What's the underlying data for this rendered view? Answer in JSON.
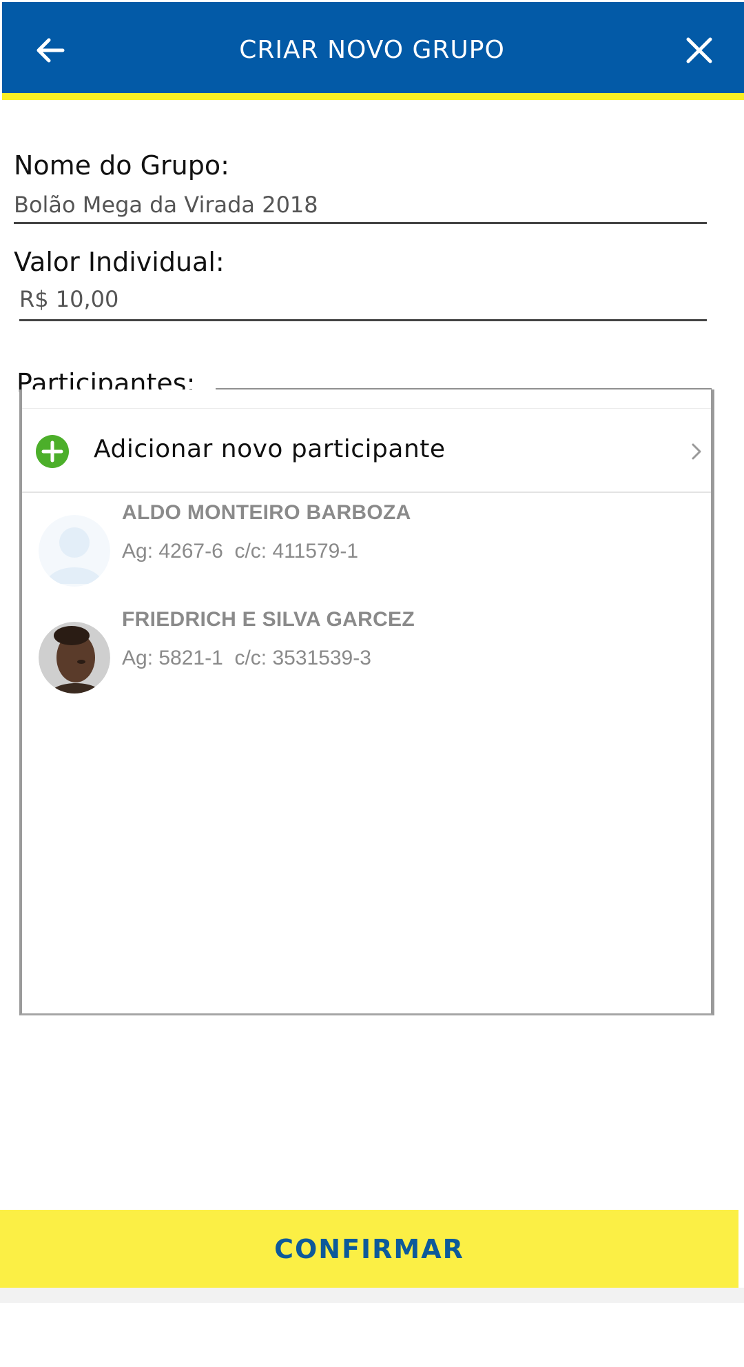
{
  "header": {
    "title": "CRIAR NOVO GRUPO",
    "back_icon": "arrow-left-icon",
    "close_icon": "close-icon",
    "bg_color": "#035AA7",
    "stripe_color": "#FBEF24"
  },
  "form": {
    "group_name_label": "Nome do Grupo:",
    "group_name_value": "Bolão Mega da Virada 2018",
    "individual_value_label": "Valor Individual:",
    "individual_value_value": "R$ 10,00"
  },
  "participants": {
    "label": "Participantes:",
    "add_label": "Adicionar novo participante",
    "add_icon": "plus-circle-icon",
    "add_icon_color": "#4CAF2A",
    "list": [
      {
        "name": "ALDO MONTEIRO BARBOZA",
        "account": "Ag: 4267-6  c/c: 411579-1",
        "avatar": "default-avatar-icon"
      },
      {
        "name": "FRIEDRICH E SILVA GARCEZ",
        "account": "Ag: 5821-1  c/c: 3531539-3",
        "avatar": "photo-avatar"
      }
    ]
  },
  "confirm": {
    "label": "CONFIRMAR",
    "bg_color": "#FBEF45",
    "text_color": "#0D5A9A"
  }
}
